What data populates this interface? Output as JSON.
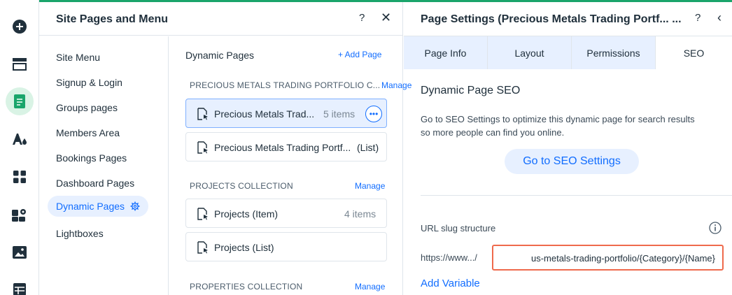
{
  "colors": {
    "accent": "#116dff",
    "active_bg": "#e7f0ff",
    "brand_green": "#1aa56b",
    "highlight_border": "#ef6a4c"
  },
  "rail": {
    "icons": [
      "add-icon",
      "sections-icon",
      "pages-icon",
      "design-icon",
      "apps-icon",
      "business-icon",
      "media-icon",
      "cms-icon"
    ]
  },
  "site_pages": {
    "title": "Site Pages and Menu",
    "help": "?",
    "close": "✕",
    "menu": [
      {
        "label": "Site Menu"
      },
      {
        "label": "Signup & Login"
      },
      {
        "label": "Groups pages"
      },
      {
        "label": "Members Area"
      },
      {
        "label": "Bookings Pages"
      },
      {
        "label": "Dashboard Pages"
      },
      {
        "label": "Dynamic Pages"
      },
      {
        "label": "Lightboxes"
      }
    ],
    "dynamic": {
      "title": "Dynamic Pages",
      "add_page": "+ Add Page",
      "collections": [
        {
          "heading": "PRECIOUS METALS TRADING PORTFOLIO C...",
          "manage": "Manage",
          "pages": [
            {
              "name": "Precious Metals Trad...",
              "meta": "5 items"
            },
            {
              "name": "Precious Metals Trading Portf...",
              "meta": "(List)"
            }
          ]
        },
        {
          "heading": "PROJECTS COLLECTION",
          "manage": "Manage",
          "pages": [
            {
              "name": "Projects (Item)",
              "meta": "4 items"
            },
            {
              "name": "Projects (List)",
              "meta": ""
            }
          ]
        },
        {
          "heading": "PROPERTIES COLLECTION",
          "manage": "Manage"
        }
      ]
    }
  },
  "page_settings": {
    "title": "Page Settings (Precious Metals Trading Portf... ...",
    "help": "?",
    "back": "‹",
    "tabs": [
      {
        "label": "Page Info"
      },
      {
        "label": "Layout"
      },
      {
        "label": "Permissions"
      },
      {
        "label": "SEO"
      }
    ],
    "seo": {
      "heading": "Dynamic Page SEO",
      "description": "Go to SEO Settings to optimize this dynamic page for search results so more people can find you online.",
      "button": "Go to SEO Settings",
      "slug_label": "URL slug structure",
      "url_prefix": "https://www.../",
      "slug_value": "us-metals-trading-portfolio/{Category}/{Name}",
      "add_variable": "Add Variable"
    }
  }
}
